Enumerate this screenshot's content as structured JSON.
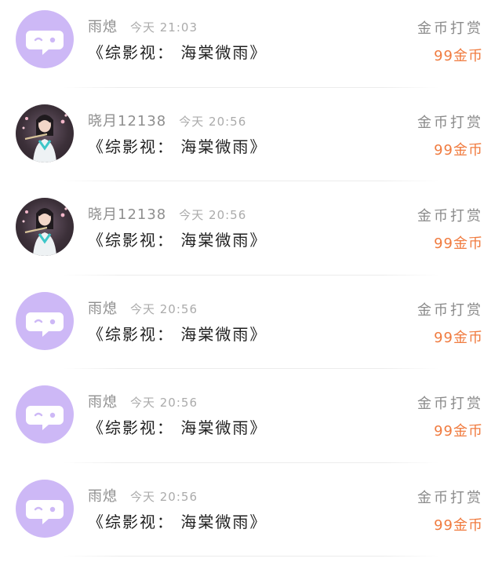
{
  "records": [
    {
      "avatar": "chat-bubble-avatar",
      "username": "雨熄",
      "time": "今天 21:03",
      "title": "《综影视： 海棠微雨》",
      "reward_label": "金币打赏",
      "reward_amount": "99金币"
    },
    {
      "avatar": "user-photo-avatar",
      "username": "晓月12138",
      "time": "今天 20:56",
      "title": "《综影视： 海棠微雨》",
      "reward_label": "金币打赏",
      "reward_amount": "99金币"
    },
    {
      "avatar": "user-photo-avatar",
      "username": "晓月12138",
      "time": "今天 20:56",
      "title": "《综影视： 海棠微雨》",
      "reward_label": "金币打赏",
      "reward_amount": "99金币"
    },
    {
      "avatar": "chat-bubble-avatar",
      "username": "雨熄",
      "time": "今天 20:56",
      "title": "《综影视： 海棠微雨》",
      "reward_label": "金币打赏",
      "reward_amount": "99金币"
    },
    {
      "avatar": "chat-bubble-avatar",
      "username": "雨熄",
      "time": "今天 20:56",
      "title": "《综影视： 海棠微雨》",
      "reward_label": "金币打赏",
      "reward_amount": "99金币"
    },
    {
      "avatar": "chat-bubble-avatar",
      "username": "雨熄",
      "time": "今天 20:56",
      "title": "《综影视： 海棠微雨》",
      "reward_label": "金币打赏",
      "reward_amount": "99金币"
    }
  ],
  "colors": {
    "bot_avatar_bg": "#cdb8f6",
    "reward_accent": "#f07b3f"
  }
}
